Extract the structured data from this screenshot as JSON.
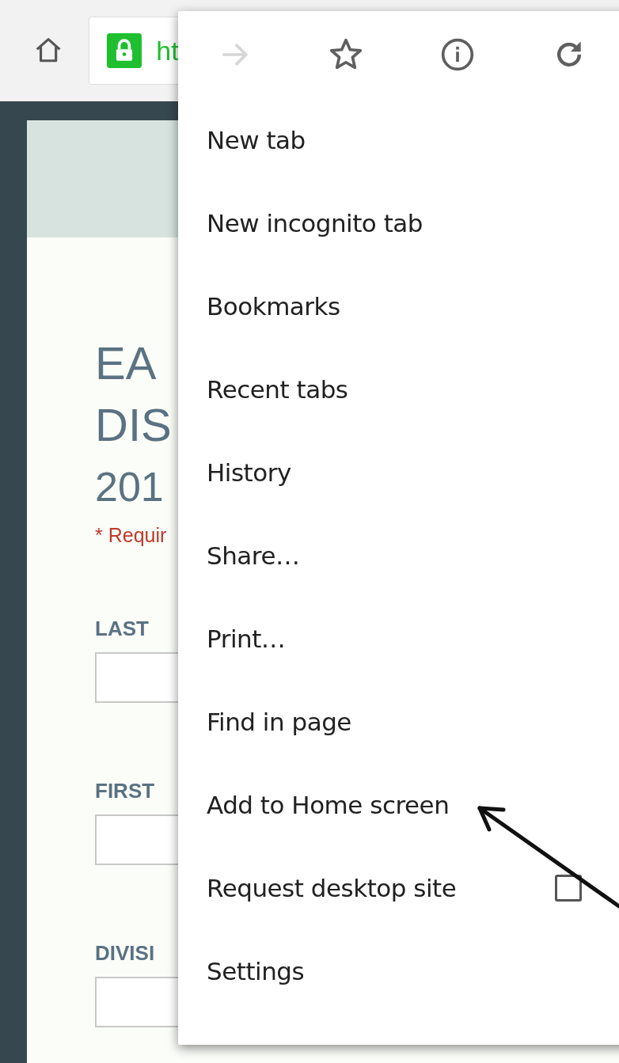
{
  "toolbar": {
    "url": "ht"
  },
  "page": {
    "title_lines": [
      "EA",
      "DIS",
      "201"
    ],
    "required_note": "* Requir",
    "fields": [
      {
        "label": "LAST"
      },
      {
        "label": "FIRST"
      },
      {
        "label": "DIVISI"
      }
    ]
  },
  "menu": {
    "icons": [
      {
        "kind": "forward",
        "disabled": true
      },
      {
        "kind": "star",
        "disabled": false
      },
      {
        "kind": "info",
        "disabled": false
      },
      {
        "kind": "reload",
        "disabled": false
      }
    ],
    "items": [
      {
        "label": "New tab",
        "kind": "plain"
      },
      {
        "label": "New incognito tab",
        "kind": "plain"
      },
      {
        "label": "Bookmarks",
        "kind": "plain"
      },
      {
        "label": "Recent tabs",
        "kind": "plain"
      },
      {
        "label": "History",
        "kind": "plain"
      },
      {
        "label": "Share…",
        "kind": "plain"
      },
      {
        "label": "Print…",
        "kind": "plain"
      },
      {
        "label": "Find in page",
        "kind": "plain"
      },
      {
        "label": "Add to Home screen",
        "kind": "plain"
      },
      {
        "label": "Request desktop site",
        "kind": "checkbox",
        "checked": false
      },
      {
        "label": "Settings",
        "kind": "plain"
      }
    ]
  }
}
